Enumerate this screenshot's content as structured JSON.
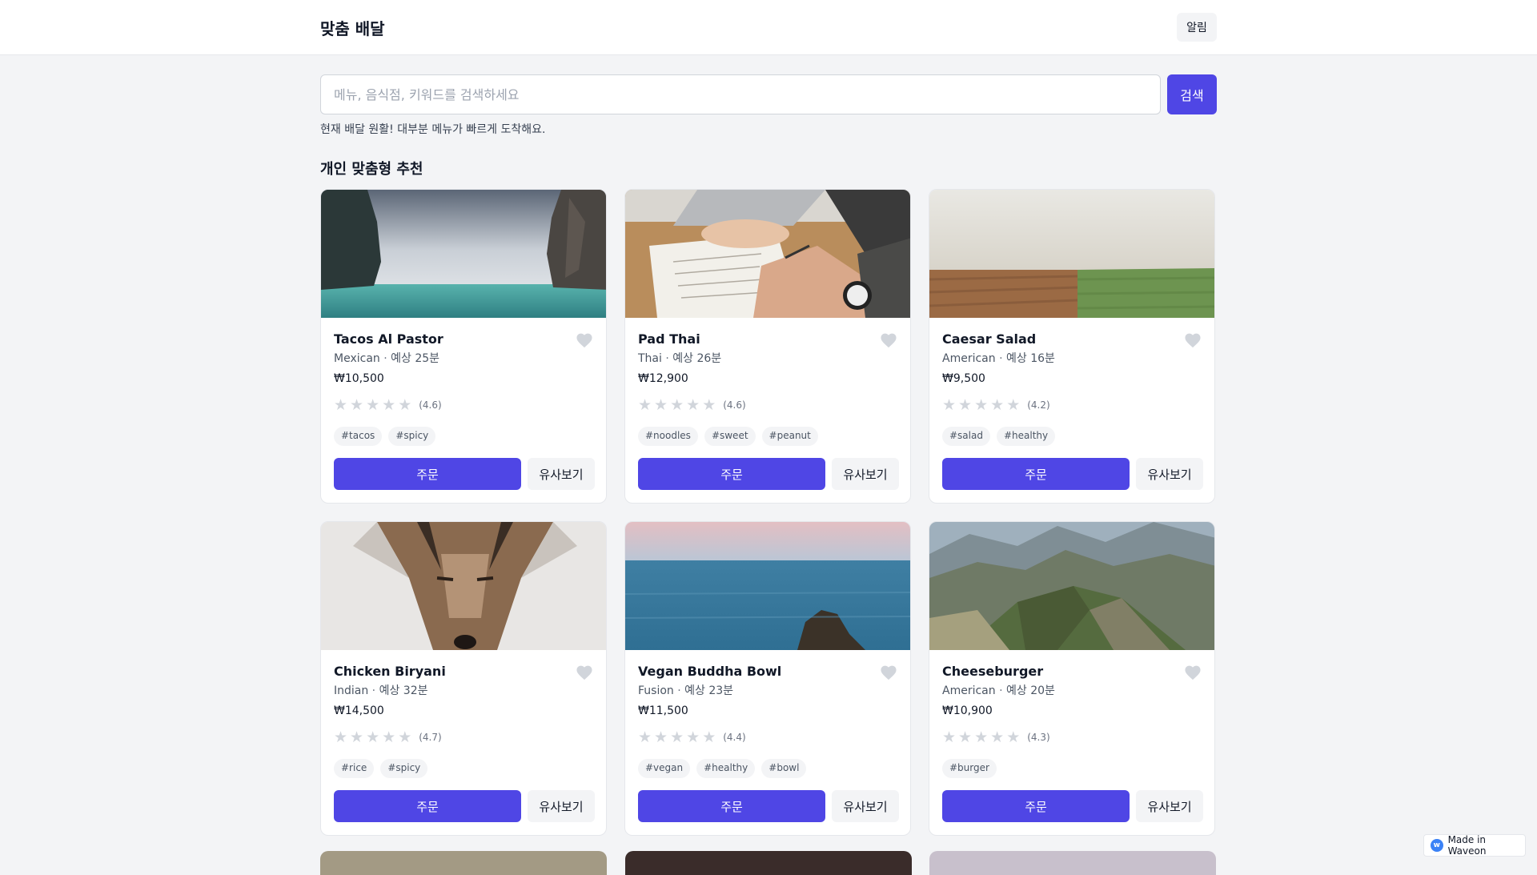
{
  "header": {
    "brand": "맞춤 배달",
    "notification_label": "알림"
  },
  "search": {
    "placeholder": "메뉴, 음식점, 키워드를 검색하세요",
    "value": "",
    "button_label": "검색"
  },
  "status_text": "현재 배달 원활! 대부분 메뉴가 빠르게 도착해요.",
  "section_title": "개인 맞춤형 추천",
  "card_labels": {
    "order": "주문",
    "similar": "유사보기",
    "separator": " · "
  },
  "cards": [
    {
      "name": "Tacos Al Pastor",
      "cuisine": "Mexican",
      "eta": "예상 25분",
      "price": "₩10,500",
      "rating": 4.6,
      "rating_text": "(4.6)",
      "tags": [
        "#tacos",
        "#spicy"
      ],
      "image": "sea-cliffs"
    },
    {
      "name": "Pad Thai",
      "cuisine": "Thai",
      "eta": "예상 26분",
      "price": "₩12,900",
      "rating": 4.6,
      "rating_text": "(4.6)",
      "tags": [
        "#noodles",
        "#sweet",
        "#peanut"
      ],
      "image": "writing-hands"
    },
    {
      "name": "Caesar Salad",
      "cuisine": "American",
      "eta": "예상 16분",
      "price": "₩9,500",
      "rating": 4.2,
      "rating_text": "(4.2)",
      "tags": [
        "#salad",
        "#healthy"
      ],
      "image": "field"
    },
    {
      "name": "Chicken Biryani",
      "cuisine": "Indian",
      "eta": "예상 32분",
      "price": "₩14,500",
      "rating": 4.7,
      "rating_text": "(4.7)",
      "tags": [
        "#rice",
        "#spicy"
      ],
      "image": "coyote"
    },
    {
      "name": "Vegan Buddha Bowl",
      "cuisine": "Fusion",
      "eta": "예상 23분",
      "price": "₩11,500",
      "rating": 4.4,
      "rating_text": "(4.4)",
      "tags": [
        "#vegan",
        "#healthy",
        "#bowl"
      ],
      "image": "ocean-rock"
    },
    {
      "name": "Cheeseburger",
      "cuisine": "American",
      "eta": "예상 20분",
      "price": "₩10,900",
      "rating": 4.3,
      "rating_text": "(4.3)",
      "tags": [
        "#burger"
      ],
      "image": "mountains"
    }
  ],
  "badge": {
    "label": "Made in Waveon",
    "icon": "waveon-logo-icon"
  },
  "colors": {
    "primary": "#4f46e5",
    "background": "#f3f4f6",
    "star_empty": "#d1d5db",
    "heart": "#d1d5db"
  }
}
